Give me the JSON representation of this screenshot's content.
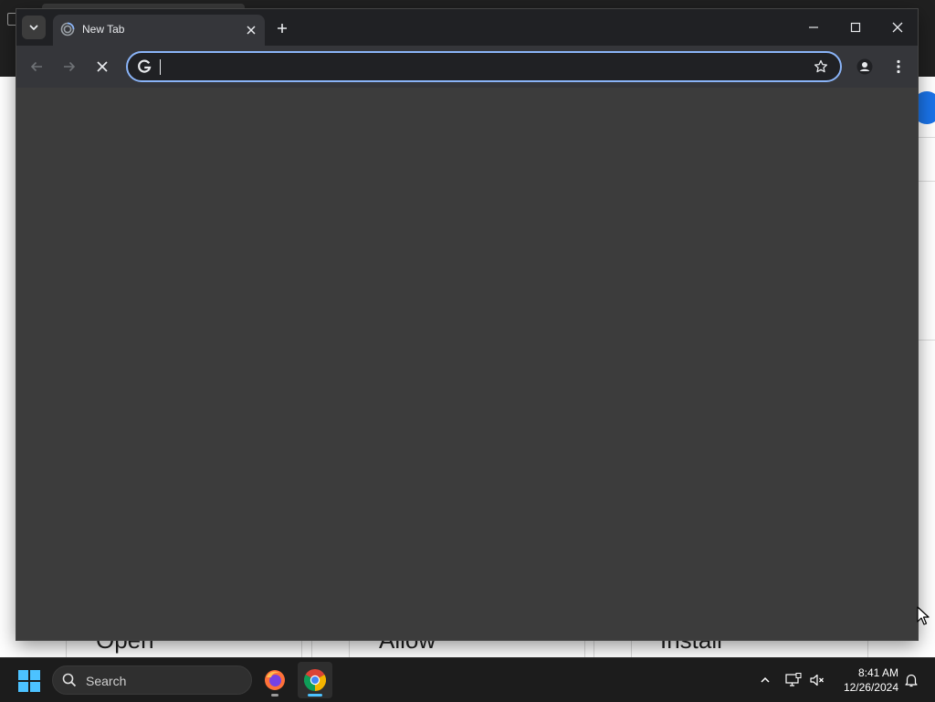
{
  "background_app": {
    "buttons": [
      "Open",
      "Allow",
      "Install"
    ]
  },
  "browser": {
    "tabs": [
      {
        "title": "New Tab",
        "favicon": "loading-spinner-icon"
      }
    ],
    "omnibox": {
      "value": "",
      "placeholder": ""
    },
    "accent_color": "#8ab4f8",
    "content_color": "#3c3c3c"
  },
  "taskbar": {
    "search_label": "Search",
    "apps": [
      "firefox-icon",
      "chrome-icon"
    ],
    "time": "8:41 AM",
    "date": "12/26/2024"
  }
}
